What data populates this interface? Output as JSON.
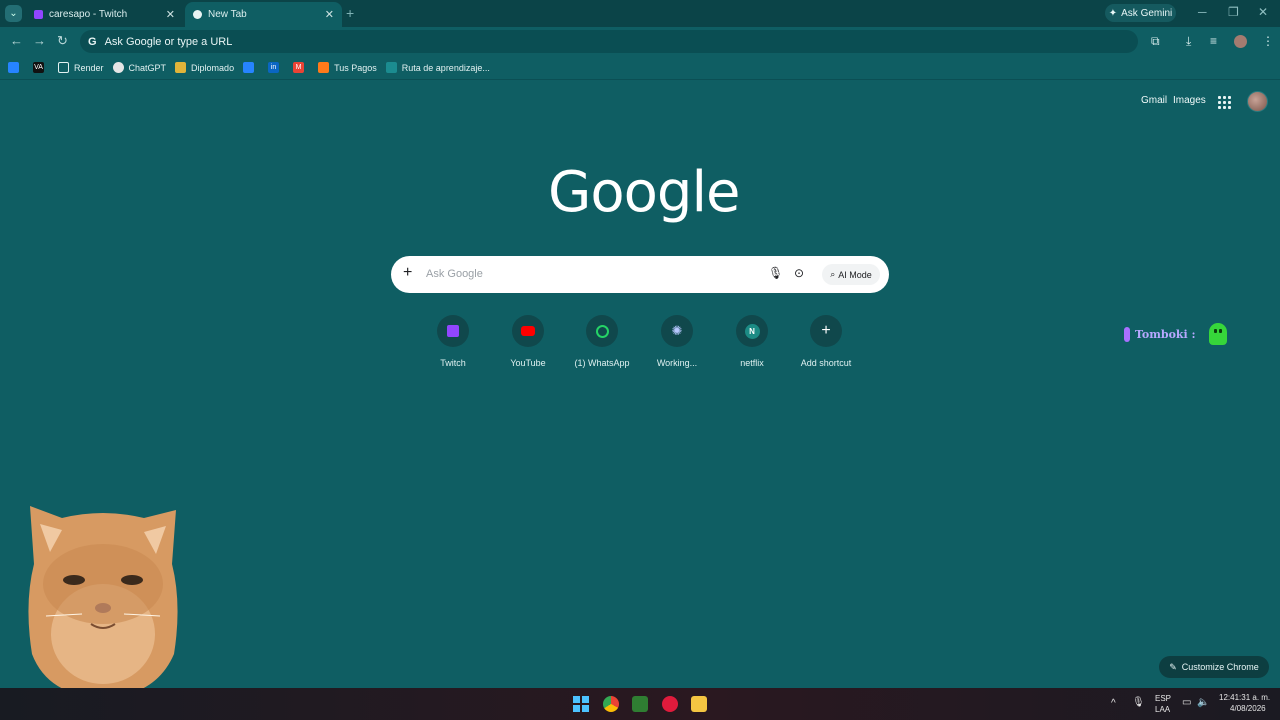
{
  "browser": {
    "tabs": [
      {
        "title": "caresapo - Twitch",
        "active": false,
        "favicon": "twitch-icon"
      },
      {
        "title": "New Tab",
        "active": true,
        "favicon": "chrome-icon"
      }
    ],
    "ask_gemini": "Ask Gemini",
    "omnibox_placeholder": "Ask Google or type a URL"
  },
  "bookmarks": [
    {
      "label": "",
      "icon": "jira-icon"
    },
    {
      "label": "",
      "icon": "va-icon"
    },
    {
      "label": "Render",
      "icon": "folder-icon"
    },
    {
      "label": "ChatGPT",
      "icon": "chatgpt-icon"
    },
    {
      "label": "Diplomado",
      "icon": "pen-icon"
    },
    {
      "label": "",
      "icon": "jira-icon"
    },
    {
      "label": "",
      "icon": "linkedin-icon"
    },
    {
      "label": "",
      "icon": "gmail-icon"
    },
    {
      "label": "Tus Pagos",
      "icon": "payments-icon"
    },
    {
      "label": "Ruta de aprendizaje...",
      "icon": "route-icon"
    }
  ],
  "header": {
    "gmail": "Gmail",
    "images": "Images"
  },
  "logo": "Google",
  "search": {
    "placeholder": "Ask Google",
    "ai_mode": "AI Mode"
  },
  "shortcuts": [
    {
      "label": "Twitch",
      "icon": "twitch-icon",
      "color": "#9146ff"
    },
    {
      "label": "YouTube",
      "icon": "youtube-icon",
      "color": "#ff0000"
    },
    {
      "label": "(1) WhatsApp",
      "icon": "whatsapp-icon",
      "color": "#25d366"
    },
    {
      "label": "Working...",
      "icon": "gear-icon",
      "color": "#b8c8ff"
    },
    {
      "label": "netflix",
      "icon": "netflix-icon",
      "letter": "N",
      "color": "#1c8b85"
    },
    {
      "label": "Add shortcut",
      "icon": "plus-icon",
      "color": "#ffffff"
    }
  ],
  "tomboki": {
    "text": "Tomboki :"
  },
  "customize": "Customize Chrome",
  "taskbar": {
    "lang_1": "ESP",
    "lang_2": "LAA",
    "time": "12:41:31 a. m.",
    "date": "4/08/2026"
  }
}
